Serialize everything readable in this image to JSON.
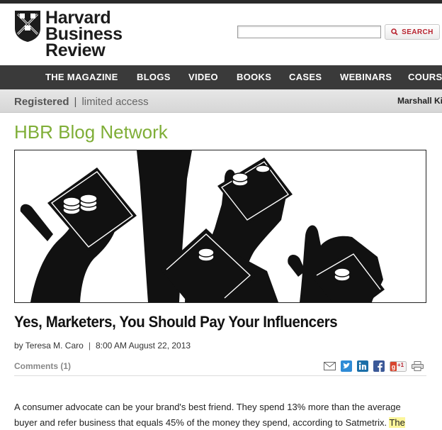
{
  "header": {
    "logo_lines": [
      "Harvard",
      "Business",
      "Review"
    ],
    "search_placeholder": "",
    "search_label": "SEARCH"
  },
  "nav": {
    "items": [
      "THE MAGAZINE",
      "BLOGS",
      "VIDEO",
      "BOOKS",
      "CASES",
      "WEBINARS",
      "COURSE"
    ]
  },
  "access": {
    "registered": "Registered",
    "separator": "|",
    "limited": "limited access",
    "user": "Marshall Ki"
  },
  "blog_network": "HBR Blog Network",
  "article": {
    "title": "Yes, Marketers, You Should Pay Your Influencers",
    "byline": {
      "author": "by Teresa M. Caro",
      "separator": "|",
      "datetime": "8:00 AM August 22, 2013"
    },
    "comments": "Comments (1)",
    "share_icons": [
      "email-icon",
      "twitter-icon",
      "linkedin-icon",
      "facebook-icon",
      "google-plus-icon",
      "print-icon"
    ],
    "gplus_label": "+1",
    "body_line1": "A consumer advocate can be your brand's best friend. They spend 13% more than the average",
    "body_line2_plain": "buyer and refer business that equals 45% of the money they spend, according to Satmetrix. ",
    "body_line2_highlight": "The"
  },
  "colors": {
    "accent_red": "#b8232f",
    "blog_green": "#7fae37",
    "nav_bg": "#3a3a3a",
    "highlight": "#fbf59a"
  }
}
